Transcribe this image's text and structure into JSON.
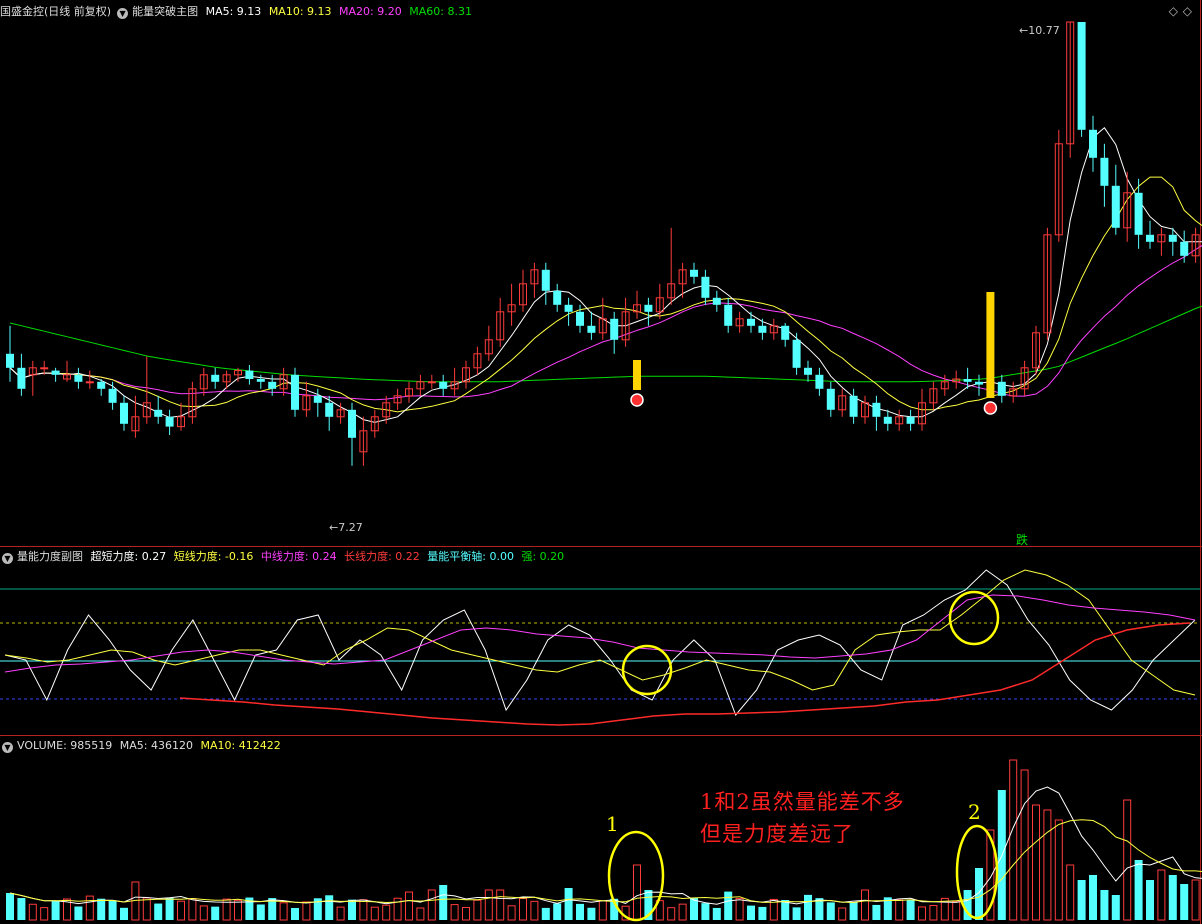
{
  "colors": {
    "bg": "#000000",
    "up": "#ff3b3b",
    "down": "#54ffff",
    "ma5": "#ffffff",
    "ma10": "#ffff40",
    "ma20": "#ff40ff",
    "ma60": "#00dd00",
    "frame": "#b22222",
    "annot_red": "#ff2020",
    "annot_yellow": "#ffff00"
  },
  "main": {
    "stock_name": "国盛金控(日线 前复权)",
    "indicator": "能量突破主图",
    "ma5_label": "MA5: 9.13",
    "ma10_label": "MA10: 9.13",
    "ma20_label": "MA20: 9.20",
    "ma60_label": "MA60: 8.31",
    "high_label": "10.77",
    "low_label": "7.27",
    "signal_label": "跌",
    "diamond_icon": "diamond-icon"
  },
  "sub": {
    "title": "量能力度副图",
    "l1": "超短力度: 0.27",
    "l2": "短线力度: -0.16",
    "l3": "中线力度: 0.24",
    "l4": "长线力度: 0.22",
    "l5": "量能平衡轴: 0.00",
    "l6": "强: 0.20"
  },
  "vol": {
    "label": "VOLUME: 985519",
    "ma5_label": "MA5: 436120",
    "ma10_label": "MA10: 412422"
  },
  "annotations": {
    "mark1": "1",
    "mark2": "2",
    "text_line1": "1和2虽然量能差不多",
    "text_line2": "但是力度差远了"
  },
  "chart_data": {
    "type": "candlestick",
    "price_range": [
      7.27,
      10.77
    ],
    "ma": {
      "MA5": 9.13,
      "MA10": 9.13,
      "MA20": 9.2,
      "MA60": 8.31
    },
    "volume_last": 985519,
    "volume_ma5": 436120,
    "volume_ma10": 412422,
    "candles": [
      [
        8.4,
        8.3,
        8.6,
        8.2
      ],
      [
        8.3,
        8.15,
        8.4,
        8.1
      ],
      [
        8.25,
        8.3,
        8.35,
        8.1
      ],
      [
        8.3,
        8.3,
        8.35,
        8.25
      ],
      [
        8.28,
        8.25,
        8.3,
        8.2
      ],
      [
        8.22,
        8.25,
        8.35,
        8.2
      ],
      [
        8.25,
        8.2,
        8.3,
        8.15
      ],
      [
        8.2,
        8.2,
        8.28,
        8.15
      ],
      [
        8.2,
        8.15,
        8.22,
        8.1
      ],
      [
        8.15,
        8.05,
        8.2,
        8.0
      ],
      [
        8.05,
        7.9,
        8.1,
        7.85
      ],
      [
        7.85,
        7.95,
        8.1,
        7.8
      ],
      [
        7.95,
        8.05,
        8.38,
        7.9
      ],
      [
        8.0,
        7.95,
        8.1,
        7.9
      ],
      [
        7.95,
        7.88,
        8.0,
        7.82
      ],
      [
        7.88,
        7.95,
        8.05,
        7.85
      ],
      [
        7.95,
        8.15,
        8.2,
        7.9
      ],
      [
        8.15,
        8.25,
        8.3,
        8.1
      ],
      [
        8.25,
        8.2,
        8.3,
        8.15
      ],
      [
        8.2,
        8.25,
        8.28,
        8.15
      ],
      [
        8.25,
        8.28,
        8.3,
        8.2
      ],
      [
        8.28,
        8.22,
        8.32,
        8.18
      ],
      [
        8.22,
        8.2,
        8.25,
        8.15
      ],
      [
        8.2,
        8.15,
        8.25,
        8.1
      ],
      [
        8.15,
        8.25,
        8.3,
        8.1
      ],
      [
        8.25,
        8.0,
        8.3,
        7.95
      ],
      [
        8.0,
        8.1,
        8.2,
        7.95
      ],
      [
        8.1,
        8.05,
        8.15,
        7.95
      ],
      [
        8.05,
        7.95,
        8.1,
        7.85
      ],
      [
        7.95,
        8.0,
        8.05,
        7.9
      ],
      [
        8.0,
        7.8,
        8.05,
        7.6
      ],
      [
        7.7,
        7.85,
        7.95,
        7.6
      ],
      [
        7.85,
        7.95,
        8.0,
        7.8
      ],
      [
        7.95,
        8.05,
        8.1,
        7.9
      ],
      [
        8.05,
        8.1,
        8.15,
        8.0
      ],
      [
        8.1,
        8.15,
        8.2,
        8.05
      ],
      [
        8.15,
        8.2,
        8.25,
        8.1
      ],
      [
        8.2,
        8.2,
        8.25,
        8.15
      ],
      [
        8.2,
        8.15,
        8.25,
        8.1
      ],
      [
        8.15,
        8.2,
        8.3,
        8.1
      ],
      [
        8.2,
        8.3,
        8.35,
        8.15
      ],
      [
        8.3,
        8.4,
        8.45,
        8.25
      ],
      [
        8.4,
        8.5,
        8.6,
        8.35
      ],
      [
        8.5,
        8.7,
        8.8,
        8.45
      ],
      [
        8.7,
        8.75,
        8.9,
        8.6
      ],
      [
        8.75,
        8.9,
        9.0,
        8.7
      ],
      [
        8.9,
        9.0,
        9.05,
        8.8
      ],
      [
        9.0,
        8.85,
        9.05,
        8.75
      ],
      [
        8.85,
        8.75,
        8.9,
        8.7
      ],
      [
        8.75,
        8.7,
        8.8,
        8.6
      ],
      [
        8.7,
        8.6,
        8.75,
        8.55
      ],
      [
        8.6,
        8.55,
        8.7,
        8.5
      ],
      [
        8.55,
        8.65,
        8.8,
        8.5
      ],
      [
        8.65,
        8.5,
        8.7,
        8.4
      ],
      [
        8.5,
        8.7,
        8.8,
        8.45
      ],
      [
        8.7,
        8.75,
        8.85,
        8.65
      ],
      [
        8.75,
        8.7,
        8.8,
        8.6
      ],
      [
        8.7,
        8.8,
        8.9,
        8.65
      ],
      [
        8.8,
        8.9,
        9.3,
        8.75
      ],
      [
        8.9,
        9.0,
        9.05,
        8.8
      ],
      [
        9.0,
        8.95,
        9.05,
        8.9
      ],
      [
        8.95,
        8.8,
        9.0,
        8.75
      ],
      [
        8.8,
        8.75,
        8.85,
        8.7
      ],
      [
        8.75,
        8.6,
        8.8,
        8.55
      ],
      [
        8.6,
        8.65,
        8.7,
        8.55
      ],
      [
        8.65,
        8.6,
        8.7,
        8.55
      ],
      [
        8.6,
        8.55,
        8.65,
        8.5
      ],
      [
        8.55,
        8.6,
        8.65,
        8.5
      ],
      [
        8.6,
        8.5,
        8.62,
        8.45
      ],
      [
        8.5,
        8.3,
        8.55,
        8.25
      ],
      [
        8.3,
        8.25,
        8.35,
        8.2
      ],
      [
        8.25,
        8.15,
        8.3,
        8.1
      ],
      [
        8.15,
        8.0,
        8.2,
        7.95
      ],
      [
        8.0,
        8.1,
        8.15,
        7.95
      ],
      [
        8.1,
        7.95,
        8.15,
        7.9
      ],
      [
        7.95,
        8.05,
        8.1,
        7.9
      ],
      [
        8.05,
        7.95,
        8.1,
        7.85
      ],
      [
        7.95,
        7.9,
        8.0,
        7.85
      ],
      [
        7.9,
        7.95,
        8.0,
        7.85
      ],
      [
        7.95,
        7.9,
        8.0,
        7.85
      ],
      [
        7.9,
        8.05,
        8.15,
        7.85
      ],
      [
        8.05,
        8.15,
        8.2,
        8.0
      ],
      [
        8.15,
        8.2,
        8.25,
        8.1
      ],
      [
        8.2,
        8.22,
        8.28,
        8.15
      ],
      [
        8.22,
        8.2,
        8.3,
        8.15
      ],
      [
        8.2,
        8.18,
        8.25,
        8.1
      ],
      [
        8.18,
        8.2,
        8.25,
        8.12
      ],
      [
        8.2,
        8.1,
        8.25,
        8.05
      ],
      [
        8.1,
        8.15,
        8.2,
        8.05
      ],
      [
        8.15,
        8.3,
        8.35,
        8.1
      ],
      [
        8.3,
        8.55,
        8.6,
        8.25
      ],
      [
        8.55,
        9.25,
        9.3,
        8.5
      ],
      [
        9.25,
        9.9,
        10.0,
        9.2
      ],
      [
        9.9,
        10.77,
        10.77,
        9.8
      ],
      [
        10.77,
        10.0,
        10.77,
        9.95
      ],
      [
        10.0,
        9.8,
        10.1,
        9.7
      ],
      [
        9.8,
        9.6,
        9.9,
        9.45
      ],
      [
        9.6,
        9.3,
        9.75,
        9.25
      ],
      [
        9.3,
        9.55,
        9.7,
        9.2
      ],
      [
        9.55,
        9.25,
        9.65,
        9.15
      ],
      [
        9.25,
        9.2,
        9.35,
        9.15
      ],
      [
        9.2,
        9.25,
        9.3,
        9.1
      ],
      [
        9.25,
        9.2,
        9.3,
        9.1
      ],
      [
        9.2,
        9.1,
        9.28,
        9.05
      ],
      [
        9.1,
        9.25,
        9.3,
        9.05
      ],
      [
        9.25,
        9.2,
        9.35,
        9.15
      ],
      [
        9.2,
        9.25,
        9.3,
        9.15
      ],
      [
        9.25,
        9.22,
        9.45,
        9.15
      ],
      [
        9.22,
        9.15,
        9.28,
        9.1
      ],
      [
        9.15,
        9.2,
        9.25,
        9.1
      ],
      [
        9.2,
        9.13,
        9.6,
        9.05
      ]
    ]
  }
}
